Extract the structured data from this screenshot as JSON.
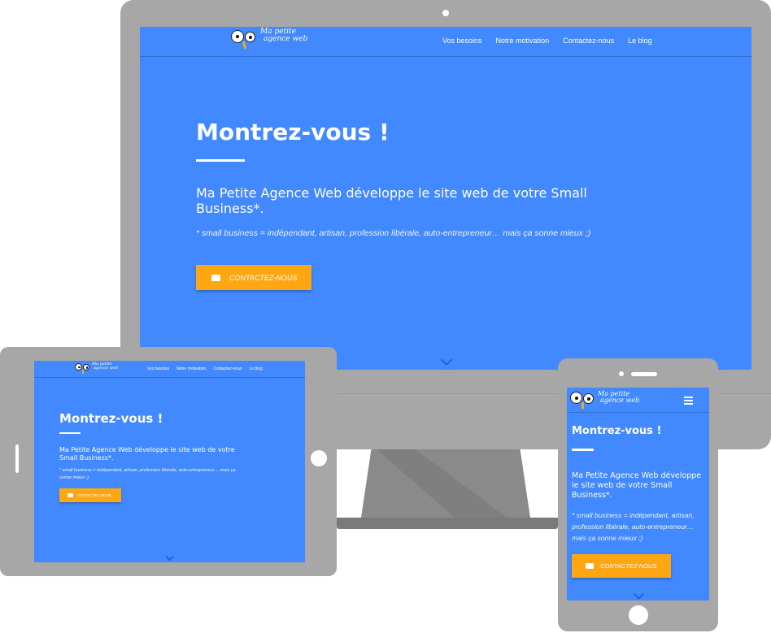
{
  "site": {
    "logo_line1": "Ma petite",
    "logo_line2": "agence web",
    "nav": [
      "Vos besoins",
      "Notre motivation",
      "Contactez-nous",
      "Le blog"
    ],
    "hero_title": "Montrez-vous !",
    "hero_subtitle": "Ma Petite Agence Web développe le site web de votre Small Business*.",
    "hero_note": "* small business = indépendant, artisan, profession libérale, auto-entrepreneur… mais ça sonne mieux ;)",
    "cta_label": "CONTACTEZ-NOUS"
  },
  "colors": {
    "brand_blue": "#4289ff",
    "cta_orange": "#ffa712",
    "device_grey": "#a7a7a7"
  },
  "icons": {
    "cta": "envelope-icon",
    "scroll": "chevron-down-icon",
    "menu": "hamburger-menu-icon"
  }
}
